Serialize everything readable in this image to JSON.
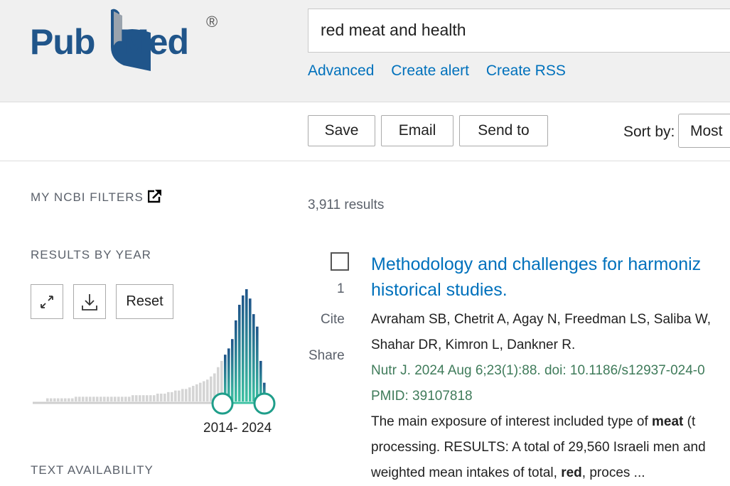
{
  "brand": {
    "name_part1": "Pub",
    "name_part2": "Med",
    "registered": "®"
  },
  "search": {
    "query": "red meat and health"
  },
  "header_links": [
    "Advanced",
    "Create alert",
    "Create RSS"
  ],
  "toolbar": {
    "save": "Save",
    "email": "Email",
    "send_to": "Send to",
    "sort_label": "Sort by:",
    "sort_value": "Most"
  },
  "sidebar": {
    "my_ncbi_filters": "MY NCBI FILTERS",
    "results_by_year": "RESULTS BY YEAR",
    "reset": "Reset",
    "year_range": "2014- 2024",
    "text_availability": "TEXT AVAILABILITY",
    "histogram": {
      "selected_range_start_index": 50,
      "bars": [
        2,
        2,
        2,
        2,
        2,
        2,
        2,
        2,
        3,
        3,
        3,
        3,
        3,
        3,
        3,
        3,
        3,
        3,
        3,
        3,
        3,
        3,
        3,
        3,
        4,
        4,
        4,
        4,
        4,
        4,
        4,
        5,
        5,
        5,
        6,
        6,
        7,
        7,
        8,
        8,
        9,
        10,
        11,
        12,
        13,
        14,
        16,
        18,
        22,
        26,
        30,
        34,
        40,
        52,
        62,
        68,
        72,
        66,
        56,
        48,
        26,
        12
      ]
    },
    "colors": {
      "selected_bar_top": "#20558a",
      "selected_bar_bottom": "#3ec1a3",
      "unselected_bar": "#d5d5d5"
    }
  },
  "results": {
    "count_text": "3,911 results",
    "items": [
      {
        "index": "1",
        "cite": "Cite",
        "share": "Share",
        "title_line1": "Methodology and challenges for harmoniz",
        "title_line2": "historical studies.",
        "authors_line1": "Avraham SB, Chetrit A, Agay N, Freedman LS, Saliba W,",
        "authors_line2": "Shahar DR, Kimron L, Dankner R.",
        "citation": "Nutr J. 2024 Aug 6;23(1):88. doi: 10.1186/s12937-024-0",
        "pmid": "PMID: 39107818",
        "snippet_1a": "The main exposure of interest included type of ",
        "snippet_1b": "meat",
        "snippet_1c": " (t",
        "snippet_2": "processing. RESULTS: A total of 29,560 Israeli men and",
        "snippet_3a": "weighted mean intakes of total, ",
        "snippet_3b": "red",
        "snippet_3c": ", proces ..."
      }
    ]
  }
}
